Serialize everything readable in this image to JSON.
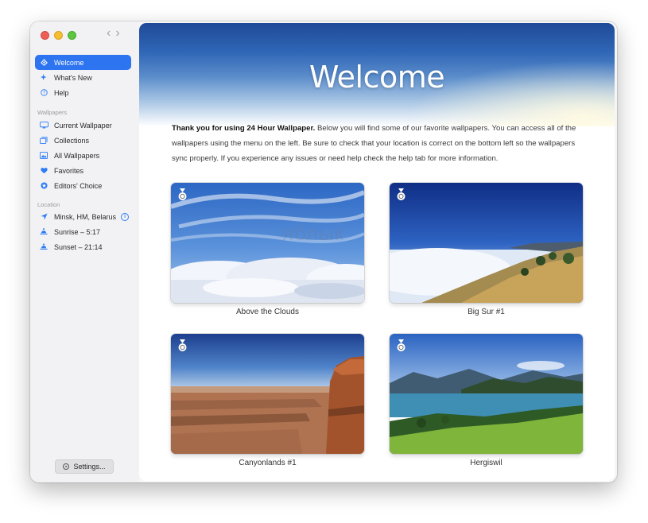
{
  "window": {
    "nav_back": "‹",
    "nav_forward": "›"
  },
  "sidebar": {
    "items": [
      {
        "label": "Welcome",
        "icon": "welcome-icon"
      },
      {
        "label": "What's New",
        "icon": "sparkle-icon"
      },
      {
        "label": "Help",
        "icon": "help-icon"
      }
    ],
    "wallpapers_title": "Wallpapers",
    "wallpaper_items": [
      {
        "label": "Current Wallpaper",
        "icon": "monitor-icon"
      },
      {
        "label": "Collections",
        "icon": "collections-icon"
      },
      {
        "label": "All Wallpapers",
        "icon": "photo-icon"
      },
      {
        "label": "Favorites",
        "icon": "heart-icon"
      },
      {
        "label": "Editors' Choice",
        "icon": "star-badge-icon"
      }
    ],
    "location_title": "Location",
    "location_items": [
      {
        "label": "Minsk, HM, Belarus",
        "icon": "location-arrow-icon"
      },
      {
        "label": "Sunrise – 5:17",
        "icon": "sunrise-icon"
      },
      {
        "label": "Sunset – 21:14",
        "icon": "sunset-icon"
      }
    ],
    "info_glyph": "i",
    "settings_label": "Settings..."
  },
  "main": {
    "title": "Welcome",
    "intro_bold": "Thank you for using 24 Hour Wallpaper.",
    "intro_rest": " Below you will find some of our favorite wallpapers. You can access all of the wallpapers using the menu on the left. Be sure to check that your location is correct on the bottom left so the wallpapers sync properly. If you experience any issues or need help check the help tab for more information.",
    "watermark": "яблык",
    "cards": [
      {
        "caption": "Above the Clouds",
        "badge": "award-badge-icon"
      },
      {
        "caption": "Big Sur #1",
        "badge": "award-badge-icon"
      },
      {
        "caption": "Canyonlands #1",
        "badge": "award-badge-icon"
      },
      {
        "caption": "Hergiswil",
        "badge": "award-badge-icon"
      }
    ]
  },
  "colors": {
    "accent": "#2d74f0",
    "sidebar_bg": "#f2f2f4",
    "hero_top": "#1f4a98"
  }
}
